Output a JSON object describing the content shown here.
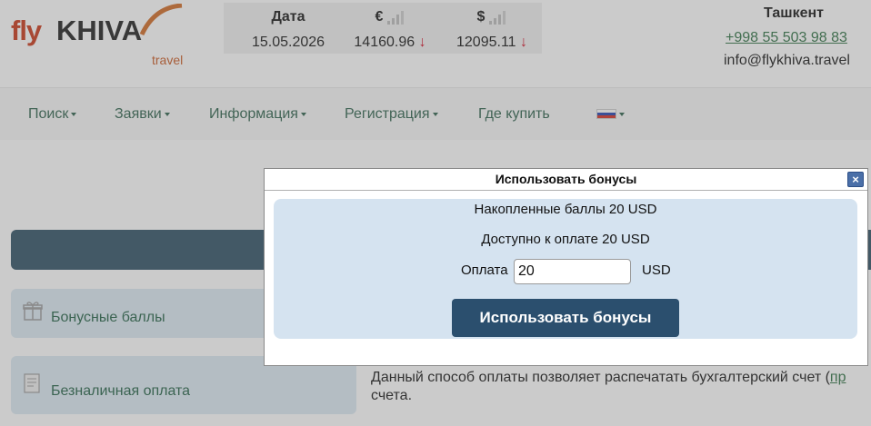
{
  "brand": {
    "fly": "fly",
    "khiva": "KHIVA",
    "travel": "travel"
  },
  "rates": {
    "date_header": "Дата",
    "date_value": "15.05.2026",
    "eur_header": "€",
    "eur_value": "14160.96",
    "usd_header": "$",
    "usd_value": "12095.11",
    "trend_symbol": "↓"
  },
  "contacts": {
    "city": "Ташкент",
    "phone": "+998 55 503 98 83",
    "email": "info@flykhiva.travel"
  },
  "nav": {
    "items": [
      {
        "label": "Поиск"
      },
      {
        "label": "Заявки"
      },
      {
        "label": "Информация"
      },
      {
        "label": "Регистрация"
      },
      {
        "label": "Где купить"
      }
    ]
  },
  "page": {
    "option_bonus": "Бонусные баллы",
    "option_cashless": "Безналичная оплата",
    "cashless_desc_a": "Данный способ оплаты позволяет распечатать бухгалтерский счет (",
    "cashless_desc_link": "пр",
    "cashless_desc_b": "счета."
  },
  "modal": {
    "title": "Использовать бонусы",
    "close": "×",
    "accumulated": "Накопленные баллы 20 USD",
    "available": "Доступно к оплате 20 USD",
    "pay_label": "Оплата",
    "pay_value": "20",
    "pay_currency": "USD",
    "button_label": "Использовать бонусы"
  },
  "colors": {
    "brand_red": "#c83214",
    "nav_green": "#2a5e48",
    "button_bg": "#2b4f6e",
    "panel_bg": "#d5e3f0"
  }
}
